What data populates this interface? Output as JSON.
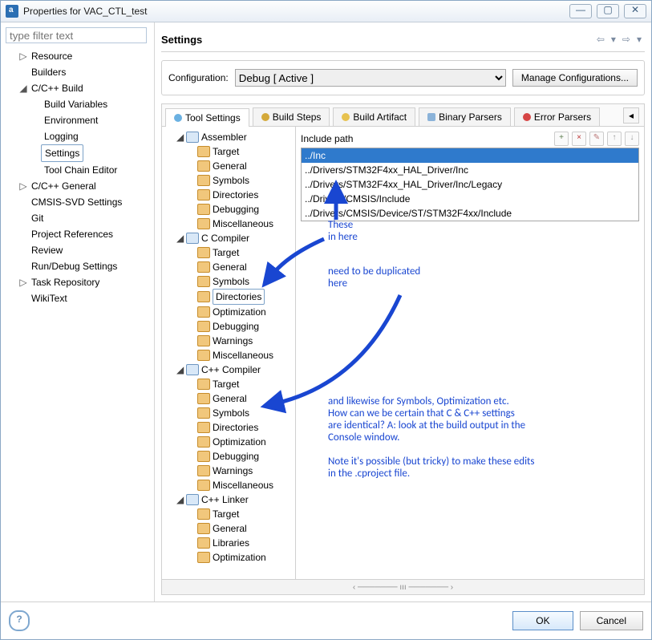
{
  "window_title": "Properties for VAC_CTL_test",
  "filter_placeholder": "type filter text",
  "nav": [
    {
      "label": "Resource",
      "expander": "▷"
    },
    {
      "label": "Builders"
    },
    {
      "label": "C/C++ Build",
      "expander": "◢",
      "children": [
        {
          "label": "Build Variables"
        },
        {
          "label": "Environment"
        },
        {
          "label": "Logging"
        },
        {
          "label": "Settings",
          "selected": true
        },
        {
          "label": "Tool Chain Editor"
        }
      ]
    },
    {
      "label": "C/C++ General",
      "expander": "▷"
    },
    {
      "label": "CMSIS-SVD Settings"
    },
    {
      "label": "Git"
    },
    {
      "label": "Project References"
    },
    {
      "label": "Review"
    },
    {
      "label": "Run/Debug Settings"
    },
    {
      "label": "Task Repository",
      "expander": "▷"
    },
    {
      "label": "WikiText"
    }
  ],
  "page_title": "Settings",
  "config_label": "Configuration:",
  "config_value": "Debug  [ Active ]",
  "manage_btn": "Manage Configurations...",
  "tabs": [
    "Tool Settings",
    "Build Steps",
    "Build Artifact",
    "Binary Parsers",
    "Error Parsers"
  ],
  "tool_tree": [
    {
      "label": "Assembler",
      "cat": true,
      "exp": "◢",
      "children": [
        "Target",
        "General",
        "Symbols",
        "Directories",
        "Debugging",
        "Miscellaneous"
      ]
    },
    {
      "label": "C Compiler",
      "cat": true,
      "exp": "◢",
      "children": [
        "Target",
        "General",
        "Symbols",
        "Directories",
        "Optimization",
        "Debugging",
        "Warnings",
        "Miscellaneous"
      ],
      "sel": "Directories"
    },
    {
      "label": "C++ Compiler",
      "cat": true,
      "exp": "◢",
      "children": [
        "Target",
        "General",
        "Symbols",
        "Directories",
        "Optimization",
        "Debugging",
        "Warnings",
        "Miscellaneous"
      ]
    },
    {
      "label": "C++ Linker",
      "cat": true,
      "exp": "◢",
      "children": [
        "Target",
        "General",
        "Libraries",
        "Optimization"
      ]
    }
  ],
  "include_label": "Include path",
  "include_paths": [
    "../Inc",
    "../Drivers/STM32F4xx_HAL_Driver/Inc",
    "../Drivers/STM32F4xx_HAL_Driver/Inc/Legacy",
    "../Drivers/CMSIS/Include",
    "../Drivers/CMSIS/Device/ST/STM32F4xx/Include"
  ],
  "anno1": "These\nin here",
  "anno2": "need to be duplicated\nhere",
  "anno3": "and likewise for Symbols, Optimization etc.\nHow can we be certain that C & C++ settings\nare identical? A: look at the build output in the\nConsole window.\n\nNote it's possible (but tricky) to make these edits\nin the .cproject file.",
  "ok_label": "OK",
  "cancel_label": "Cancel"
}
